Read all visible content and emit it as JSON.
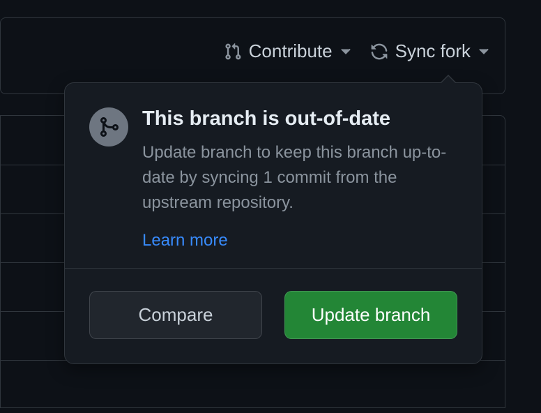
{
  "toolbar": {
    "contribute_label": "Contribute",
    "sync_fork_label": "Sync fork"
  },
  "popover": {
    "title": "This branch is out-of-date",
    "description": "Update branch to keep this branch up-to-date by syncing 1 commit from the upstream repository.",
    "learn_more_label": "Learn more",
    "compare_label": "Compare",
    "update_label": "Update branch"
  }
}
